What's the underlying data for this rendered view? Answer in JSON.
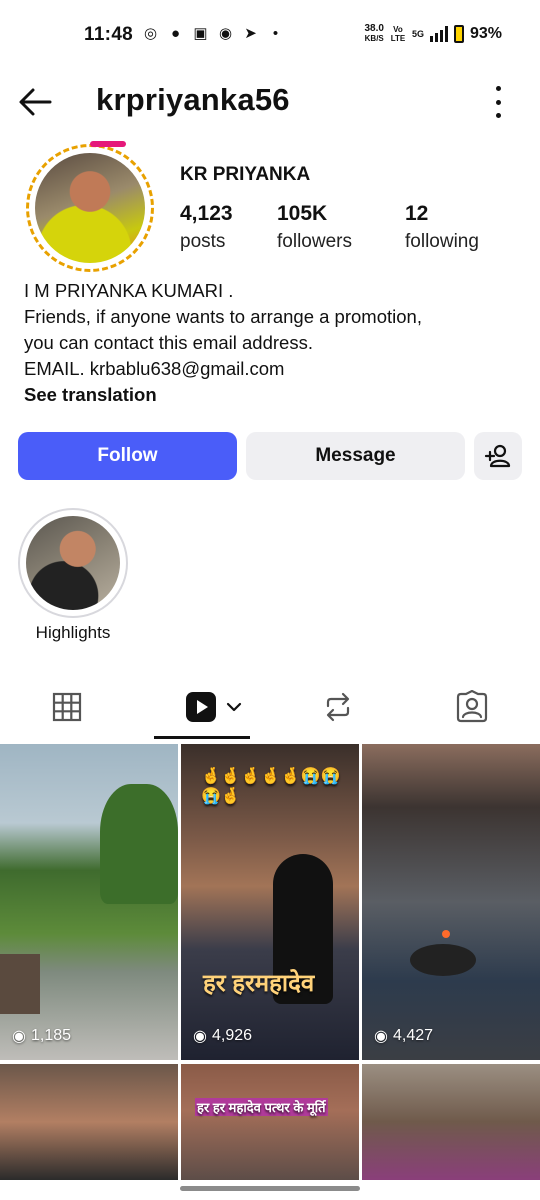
{
  "status_bar": {
    "time": "11:48",
    "net_speed_value": "38.0",
    "net_speed_unit": "KB/S",
    "volte": "Vo LTE",
    "network": "5G",
    "battery": "93%"
  },
  "header": {
    "username": "krpriyanka56"
  },
  "profile": {
    "display_name": "KR PRIYANKA",
    "stats": [
      {
        "value": "4,123",
        "label": "posts"
      },
      {
        "value": "105K",
        "label": "followers"
      },
      {
        "value": "12",
        "label": "following"
      }
    ],
    "bio": [
      "I M PRIYANKA KUMARI .",
      "Friends, if anyone wants to arrange a promotion,",
      "you can contact this email address.",
      "EMAIL. krbablu638@gmail.com"
    ],
    "see_translation": "See translation"
  },
  "actions": {
    "follow": "Follow",
    "message": "Message"
  },
  "highlights": [
    {
      "label": "Highlights"
    }
  ],
  "tabs": [
    "grid",
    "reels",
    "reposts",
    "tagged"
  ],
  "colors": {
    "follow_button": "#4a5df9",
    "secondary_button": "#efeff2",
    "story_ring_pink": "#e5197a",
    "story_ring_orange": "#e8a100"
  },
  "grid": {
    "tiles": [
      {
        "views": "1,185"
      },
      {
        "views": "4,926",
        "overlay_text": "हर हरमहादेव",
        "emoji_row": "🤞🤞🤞🤞🤞😭😭😭🤞"
      },
      {
        "views": "4,427"
      },
      {},
      {
        "overlay_text": "हर हर महादेव पत्थर के मूर्ति"
      },
      {}
    ]
  }
}
